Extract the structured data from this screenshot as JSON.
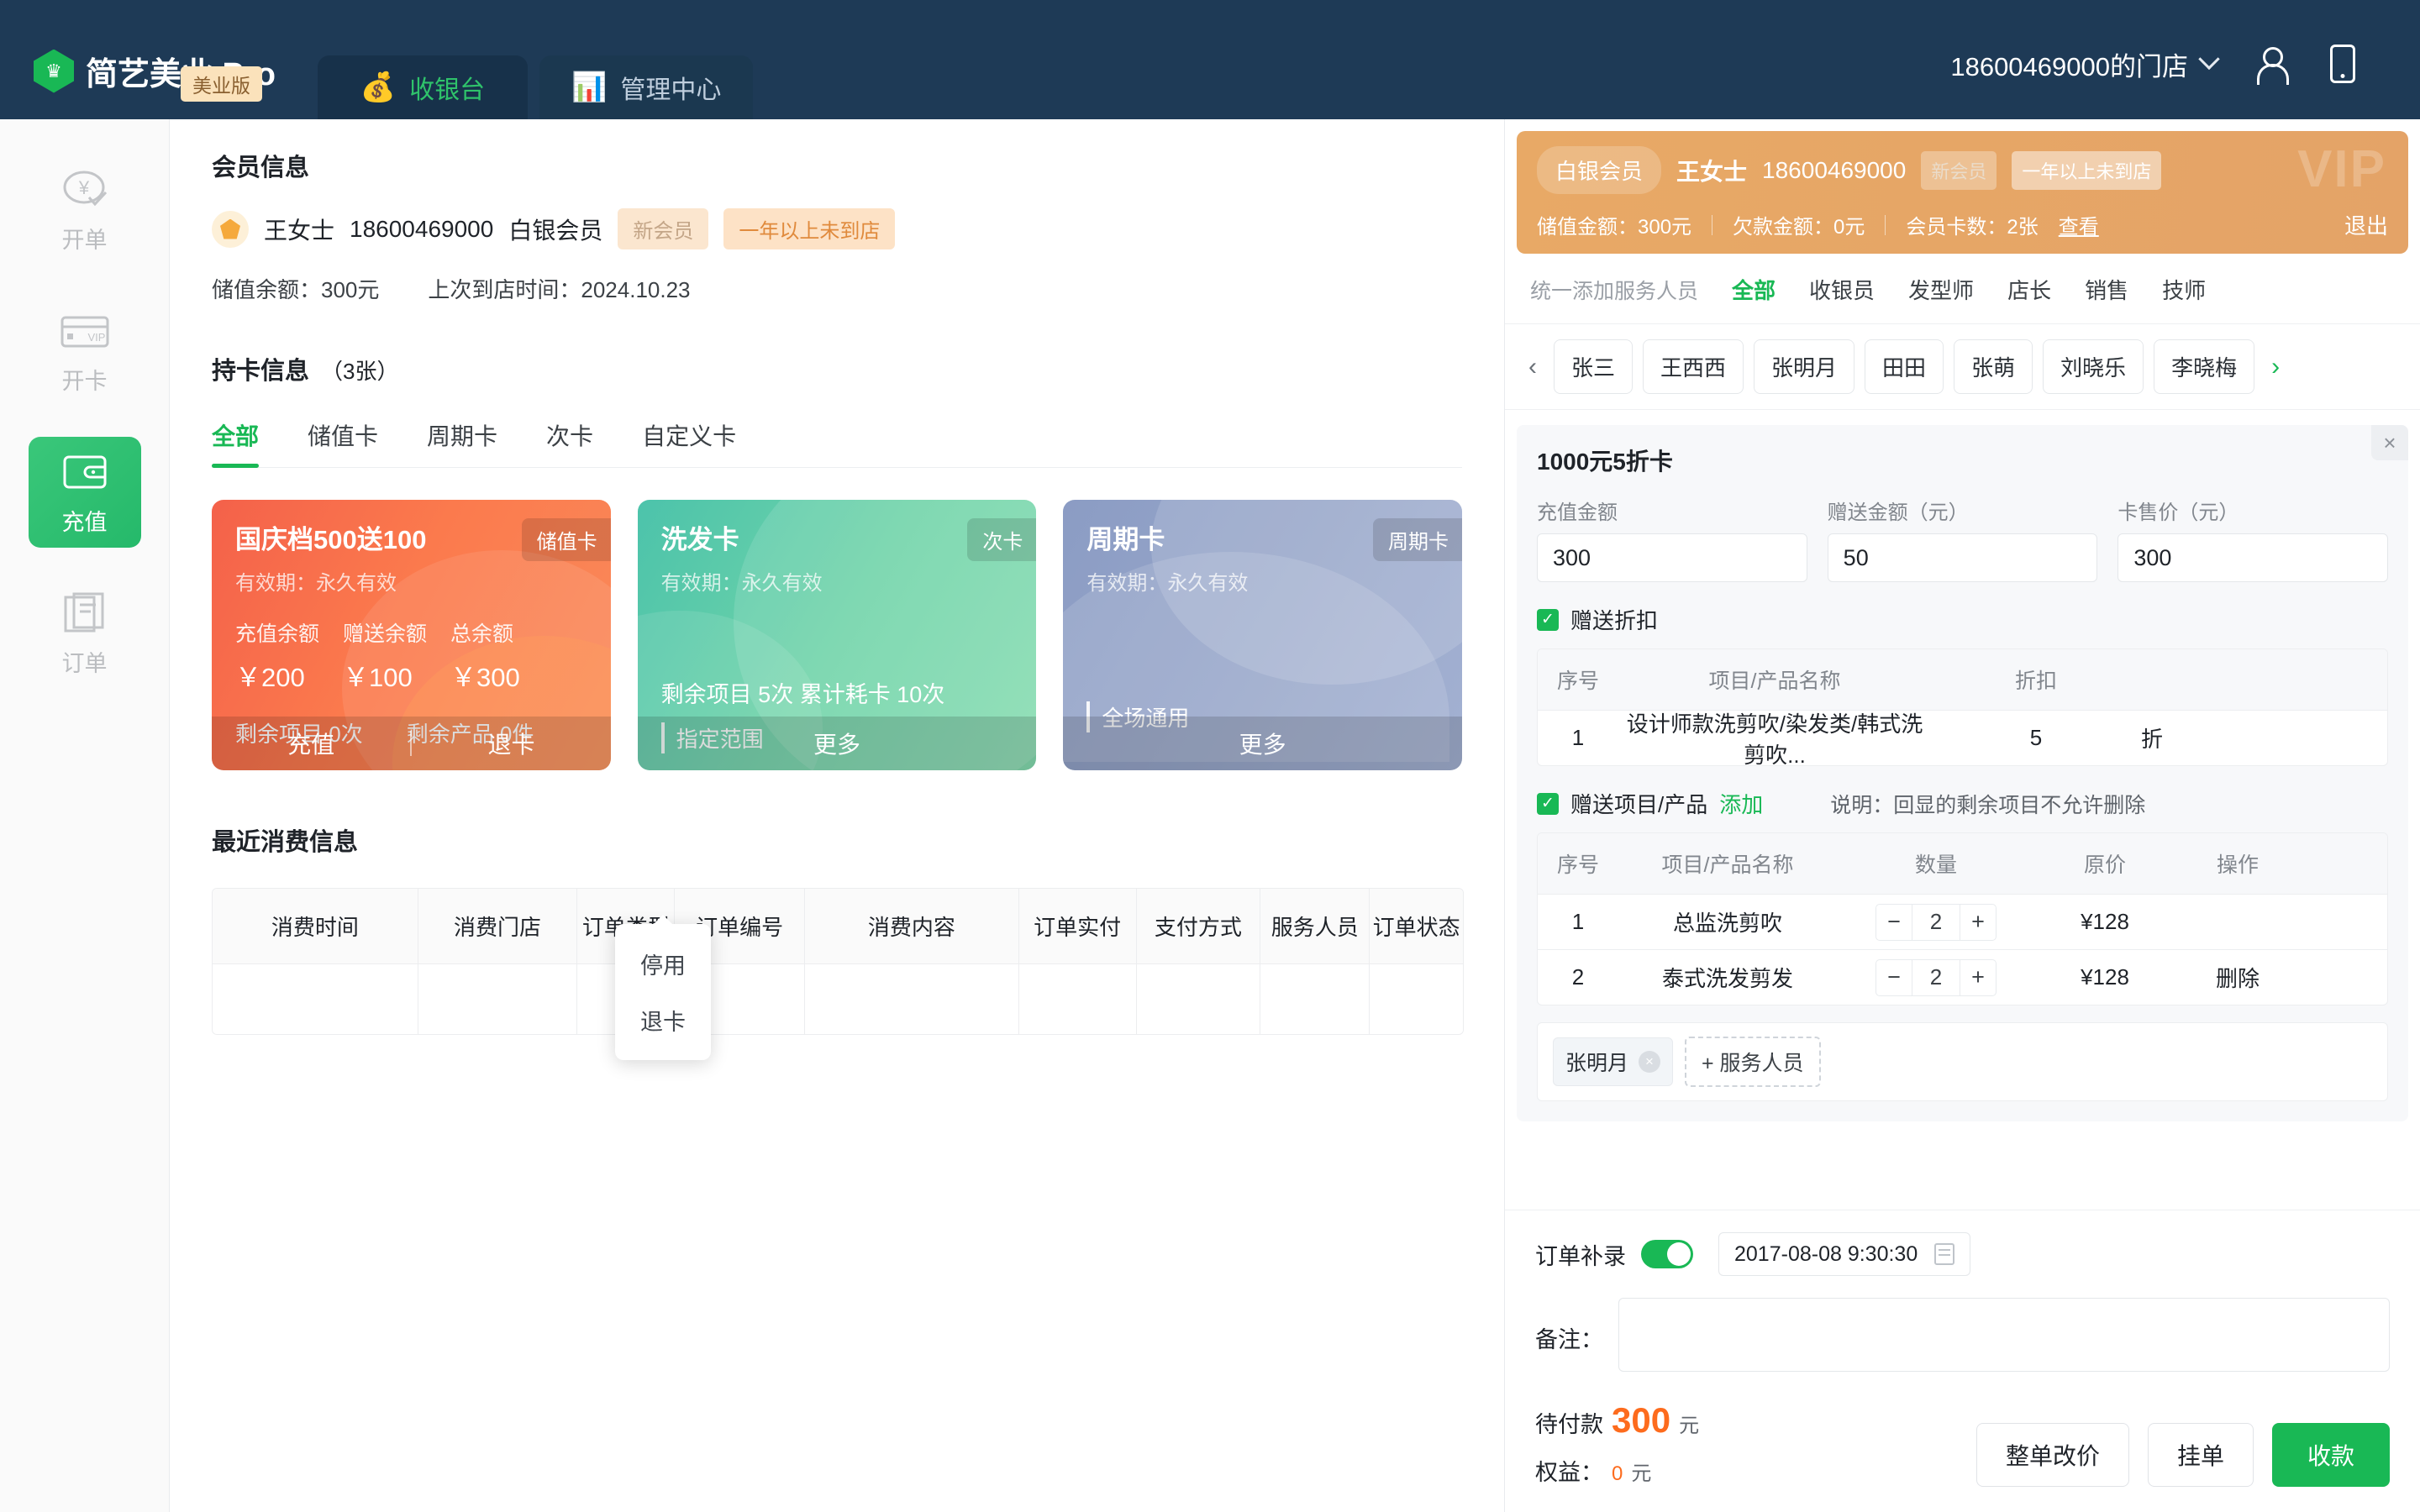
{
  "header": {
    "brand_name": "简艺美业 Pro",
    "brand_badge": "美业版",
    "logo_icon": "crown-logo-icon",
    "tabs": [
      {
        "label": "收银台",
        "icon": "money-bag-icon",
        "active": true
      },
      {
        "label": "管理中心",
        "icon": "bar-chart-icon",
        "active": false
      }
    ],
    "store_name": "18600469000的门店",
    "user_icon": "person-icon",
    "mobile_icon": "phone-icon"
  },
  "sidebar": {
    "items": [
      {
        "label": "开单",
        "icon": "order-yen-icon",
        "active": false
      },
      {
        "label": "开卡",
        "icon": "vip-card-icon",
        "active": false
      },
      {
        "label": "充值",
        "icon": "wallet-icon",
        "active": true
      },
      {
        "label": "订单",
        "icon": "clipboard-icon",
        "active": false
      }
    ]
  },
  "member": {
    "section_title": "会员信息",
    "avatar_icon": "crown-badge-icon",
    "name": "王女士",
    "phone": "18600469000",
    "level": "白银会员",
    "tag_new": "新会员",
    "tag_inactive": "一年以上未到店",
    "balance_label": "储值余额：300元",
    "last_visit_label": "上次到店时间：2024.10.23"
  },
  "cards_section": {
    "title": "持卡信息",
    "count": "（3张）",
    "tabs": [
      {
        "label": "全部",
        "active": true
      },
      {
        "label": "储值卡",
        "active": false
      },
      {
        "label": "周期卡",
        "active": false
      },
      {
        "label": "次卡",
        "active": false
      },
      {
        "label": "自定义卡",
        "active": false
      }
    ],
    "cards": [
      {
        "title": "国庆档500送100",
        "type_badge": "储值卡",
        "validity": "有效期：永久有效",
        "bal_labels": [
          "充值余额",
          "赠送余额",
          "总余额"
        ],
        "bal_values": [
          "￥200",
          "￥100",
          "￥300"
        ],
        "remain_project": "剩余项目 0次",
        "remain_product": "剩余产品 0件",
        "actions": [
          "充值",
          "退卡"
        ]
      },
      {
        "title": "洗发卡",
        "type_badge": "次卡",
        "validity": "有效期：永久有效",
        "remain_text": "剩余项目 5次    累计耗卡 10次",
        "scope": "指定范围",
        "action": "更多"
      },
      {
        "title": "周期卡",
        "type_badge": "周期卡",
        "validity": "有效期：永久有效",
        "scope": "全场通用",
        "action": "更多"
      }
    ],
    "popup_menu": [
      "停用",
      "退卡"
    ]
  },
  "recent": {
    "title": "最近消费信息",
    "columns": [
      "消费时间",
      "消费门店",
      "订单类型",
      "订单编号",
      "消费内容",
      "订单实付",
      "支付方式",
      "服务人员",
      "订单状态"
    ],
    "rows": []
  },
  "vip": {
    "level_pill": "白银会员",
    "name": "王女士",
    "phone": "18600469000",
    "tag_new": "新会员",
    "tag_inactive": "一年以上未到店",
    "watermark": "VIP",
    "stored_amount": "储值金额：300元",
    "debt_amount": "欠款金额：0元",
    "card_count": "会员卡数：2张",
    "view_link": "查看",
    "exit_label": "退出"
  },
  "staff": {
    "hint": "统一添加服务人员",
    "role_tabs": [
      {
        "label": "全部",
        "active": true
      },
      {
        "label": "收银员",
        "active": false
      },
      {
        "label": "发型师",
        "active": false
      },
      {
        "label": "店长",
        "active": false
      },
      {
        "label": "销售",
        "active": false
      },
      {
        "label": "技师",
        "active": false
      }
    ],
    "prev_icon": "chevron-left-icon",
    "next_icon": "chevron-right-icon",
    "names": [
      "张三",
      "王西西",
      "张明月",
      "田田",
      "张萌",
      "刘晓乐",
      "李晓梅"
    ]
  },
  "detail": {
    "title": "1000元5折卡",
    "close_icon": "close-icon",
    "fields": [
      {
        "label": "充值金额",
        "value": "300"
      },
      {
        "label": "赠送金额（元）",
        "value": "50"
      },
      {
        "label": "卡售价（元）",
        "value": "300"
      }
    ],
    "discount": {
      "checkbox_label": "赠送折扣",
      "checked": true,
      "columns": [
        "序号",
        "项目/产品名称",
        "折扣"
      ],
      "rows": [
        {
          "no": "1",
          "name": "设计师款洗剪吹/染发类/韩式洗剪吹...",
          "discount": "5",
          "unit": "折"
        }
      ]
    },
    "gift": {
      "checkbox_label": "赠送项目/产品",
      "checked": true,
      "add_link": "添加",
      "note": "说明：回显的剩余项目不允许删除",
      "columns": [
        "序号",
        "项目/产品名称",
        "数量",
        "原价",
        "操作"
      ],
      "rows": [
        {
          "no": "1",
          "name": "总监洗剪吹",
          "qty": "2",
          "price": "¥128",
          "action": ""
        },
        {
          "no": "2",
          "name": "泰式洗发剪发",
          "qty": "2",
          "price": "¥128",
          "action": "删除"
        }
      ],
      "minus_icon": "minus-icon",
      "plus_icon": "plus-icon"
    },
    "service_staff": {
      "selected": "张明月",
      "remove_icon": "remove-chip-icon",
      "add_label": "+ 服务人员"
    }
  },
  "bottom": {
    "supplement_label": "订单补录",
    "supplement_on": true,
    "datetime": "2017-08-08 9:30:30",
    "calendar_icon": "calendar-icon",
    "remark_label": "备注：",
    "remark_value": "",
    "pay_label": "待付款",
    "pay_amount": "300",
    "pay_unit": "元",
    "benefit_label": "权益：",
    "benefit_amount": "0",
    "benefit_unit": "元",
    "buttons": [
      {
        "label": "整单改价",
        "type": "outline"
      },
      {
        "label": "挂单",
        "type": "outline"
      },
      {
        "label": "收款",
        "type": "primary"
      }
    ]
  },
  "colors": {
    "brand_green": "#19b855",
    "header_navy": "#1e3a56",
    "vip_orange": "#e4a367",
    "pay_orange": "#fd6b1d",
    "danger_red": "#f5473b"
  }
}
